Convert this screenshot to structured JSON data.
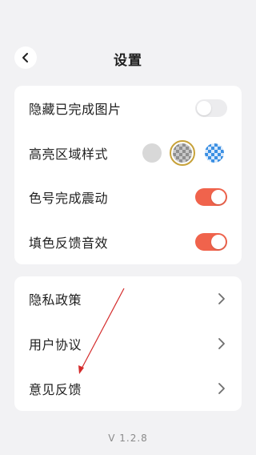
{
  "header": {
    "title": "设置",
    "back_icon": "chevron-left-icon"
  },
  "settings_card": {
    "items": [
      {
        "label": "隐藏已完成图片",
        "control": "toggle",
        "checked": false
      },
      {
        "label": "高亮区域样式",
        "control": "style-picker",
        "options": [
          "solid-grey",
          "grey-checker",
          "blue-checker"
        ],
        "selected": "grey-checker"
      },
      {
        "label": "色号完成震动",
        "control": "toggle",
        "checked": true
      },
      {
        "label": "填色反馈音效",
        "control": "toggle",
        "checked": true
      }
    ]
  },
  "links_card": {
    "items": [
      {
        "label": "隐私政策",
        "icon": "chevron-right-icon"
      },
      {
        "label": "用户协议",
        "icon": "chevron-right-icon"
      },
      {
        "label": "意见反馈",
        "icon": "chevron-right-icon"
      }
    ]
  },
  "footer": {
    "version": "V 1.2.8"
  },
  "colors": {
    "background": "#f2f2f4",
    "card": "#ffffff",
    "toggle_on": "#f0634c",
    "toggle_off": "#ececee",
    "selected_ring": "#c7a23a",
    "annotation_arrow": "#d42a2a"
  }
}
